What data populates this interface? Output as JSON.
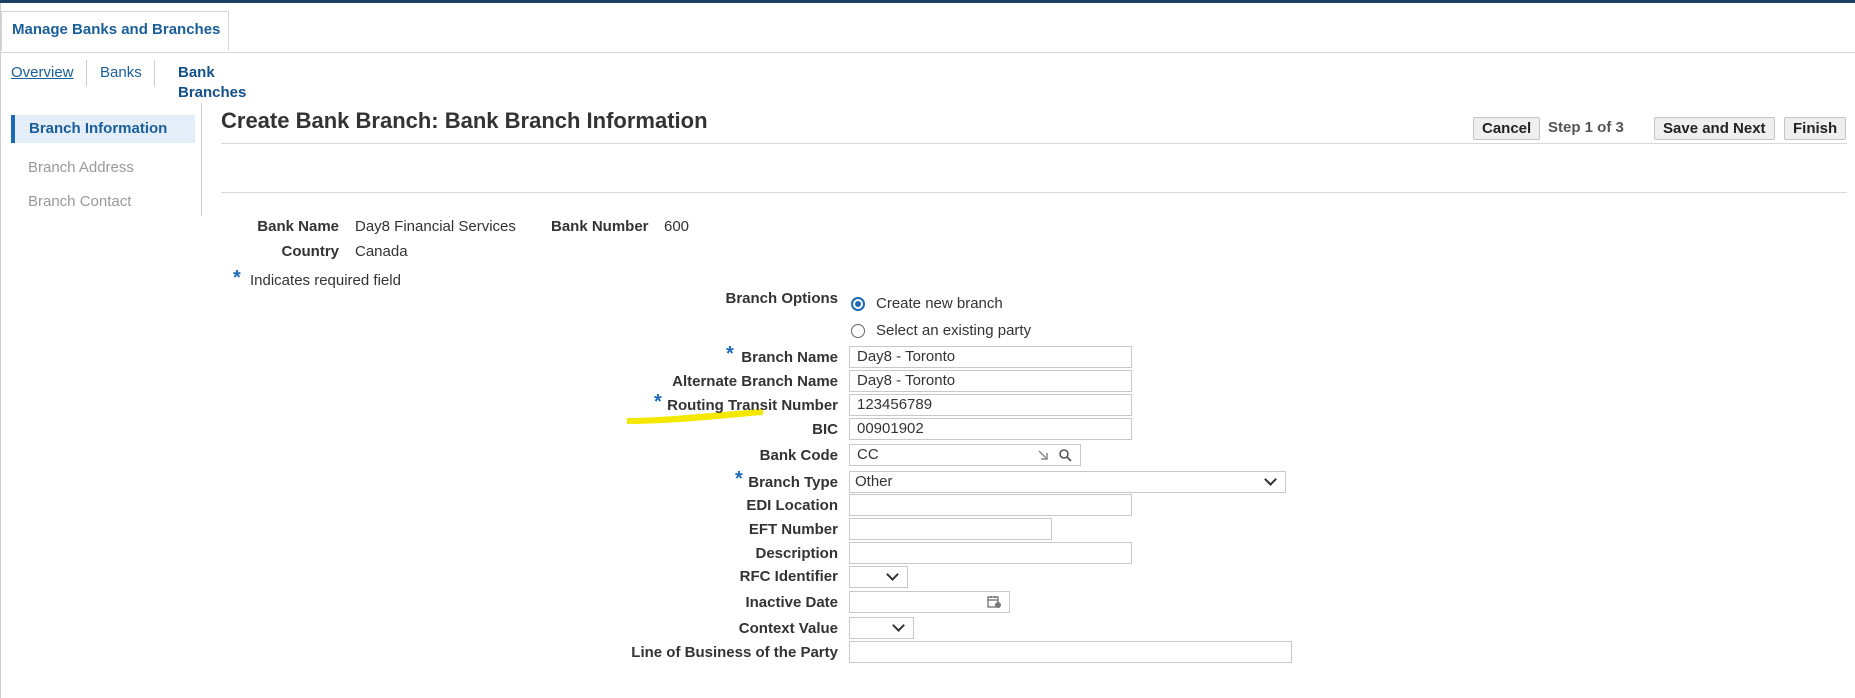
{
  "main_tab": {
    "label": "Manage Banks and Branches"
  },
  "subnav": {
    "overview": "Overview",
    "banks": "Banks",
    "bank_branches": "Bank Branches"
  },
  "train": {
    "items": [
      {
        "label": "Branch Information"
      },
      {
        "label": "Branch Address"
      },
      {
        "label": "Branch Contact"
      }
    ]
  },
  "header": {
    "title": "Create Bank Branch: Bank Branch Information",
    "cancel": "Cancel",
    "step": "Step 1 of 3",
    "save_next": "Save and Next",
    "finish": "Finish"
  },
  "summary": {
    "bank_name_label": "Bank Name",
    "bank_name_value": "Day8 Financial Services",
    "bank_number_label": "Bank Number",
    "bank_number_value": "600",
    "country_label": "Country",
    "country_value": "Canada"
  },
  "required_note": {
    "star": "*",
    "text": "Indicates required field"
  },
  "form": {
    "branch_options_label": "Branch Options",
    "option_create": "Create new branch",
    "option_existing": "Select an existing party",
    "branch_name_label": "Branch Name",
    "branch_name_value": "Day8 - Toronto",
    "alt_branch_name_label": "Alternate Branch Name",
    "alt_branch_name_value": "Day8 - Toronto",
    "routing_label": "Routing Transit Number",
    "routing_value": "123456789",
    "bic_label": "BIC",
    "bic_value": "00901902",
    "bank_code_label": "Bank Code",
    "bank_code_value": "CC",
    "branch_type_label": "Branch Type",
    "branch_type_value": "Other",
    "edi_label": "EDI Location",
    "edi_value": "",
    "eft_label": "EFT Number",
    "eft_value": "",
    "description_label": "Description",
    "description_value": "",
    "rfc_label": "RFC Identifier",
    "inactive_label": "Inactive Date",
    "inactive_value": "",
    "context_label": "Context Value",
    "lob_label": "Line of Business of the Party",
    "lob_value": ""
  },
  "colors": {
    "accent": "#1a6ab8",
    "highlight": "#f5e800"
  }
}
